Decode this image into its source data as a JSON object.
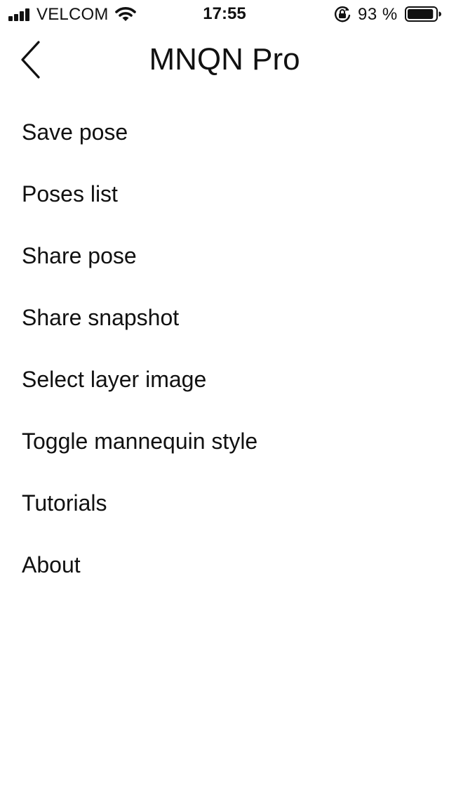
{
  "status_bar": {
    "carrier": "VELCOM",
    "time": "17:55",
    "battery_percent": "93 %",
    "battery_level": 0.93,
    "icons": [
      "signal-icon",
      "wifi-icon",
      "orientation-lock-icon",
      "battery-icon"
    ]
  },
  "nav": {
    "title": "MNQN Pro",
    "back_icon": "chevron-left-icon"
  },
  "menu": {
    "items": [
      {
        "label": "Save pose"
      },
      {
        "label": "Poses list"
      },
      {
        "label": "Share pose"
      },
      {
        "label": "Share snapshot"
      },
      {
        "label": "Select layer image"
      },
      {
        "label": "Toggle mannequin style"
      },
      {
        "label": "Tutorials"
      },
      {
        "label": "About"
      }
    ]
  },
  "colors": {
    "text": "#111111",
    "background": "#ffffff"
  }
}
